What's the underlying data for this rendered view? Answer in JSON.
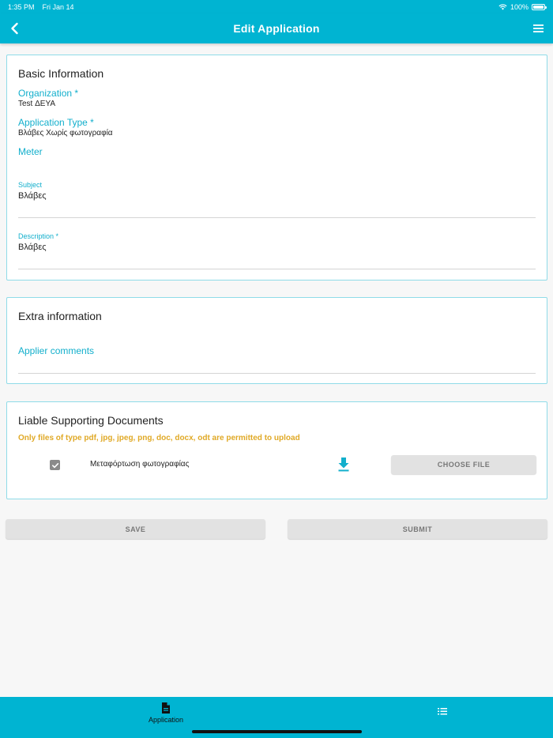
{
  "status_bar": {
    "time": "1:35 PM",
    "date": "Fri Jan 14",
    "battery_percent": "100%",
    "wifi_icon": "wifi-icon"
  },
  "nav": {
    "title": "Edit Application",
    "back_icon": "chevron-left-icon",
    "menu_icon": "hamburger-menu-icon"
  },
  "basic_info": {
    "title": "Basic Information",
    "organization": {
      "label": "Organization *",
      "value": "Test ΔΕΥΑ"
    },
    "application_type": {
      "label": "Application Type *",
      "value": "Βλάβες Χωρίς φωτογραφία"
    },
    "meter": {
      "label": "Meter"
    },
    "subject": {
      "label": "Subject",
      "value": "Βλάβες"
    },
    "description": {
      "label": "Description *",
      "value": "Βλάβες"
    }
  },
  "extra_info": {
    "title": "Extra information",
    "applier_comments": {
      "label": "Applier comments",
      "value": ""
    }
  },
  "documents": {
    "title": "Liable Supporting Documents",
    "note": "Only files of type pdf, jpg, jpeg, png, doc, docx, odt are permitted to upload",
    "items": [
      {
        "label": "Μεταφόρτωση φωτογραφίας",
        "checked": true,
        "choose_label": "CHOOSE FILE"
      }
    ]
  },
  "actions": {
    "save_label": "SAVE",
    "submit_label": "SUBMIT"
  },
  "tabs": [
    {
      "label": "Application",
      "icon": "document-icon",
      "active": true
    },
    {
      "label": "",
      "icon": "list-icon",
      "active": false
    }
  ],
  "colors": {
    "primary": "#00b4d2",
    "accent_text": "#12afcc",
    "warning_text": "#e0a926",
    "button_bg": "#e2e2e2"
  }
}
